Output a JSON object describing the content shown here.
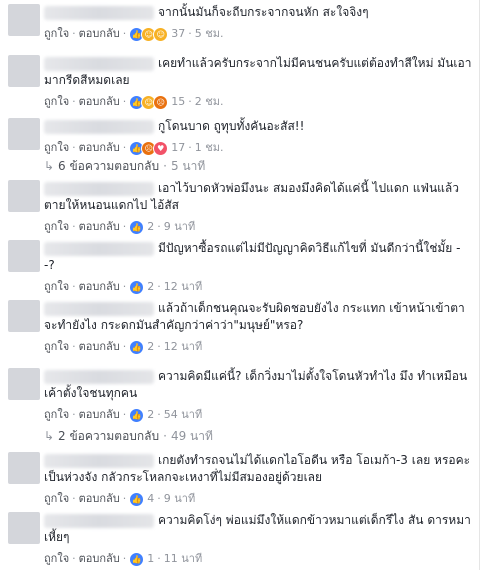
{
  "ui": {
    "like": "ถูกใจ",
    "reply": "ตอบกลับ",
    "dot": "·"
  },
  "comments": [
    {
      "text": "จากนั้นมันก็จะถีบกระจากจนหัก สะใจจิงๆ",
      "count": "37",
      "time": "5 ชม."
    },
    {
      "text": "เคยทำแล้วครับกระจากไม่มีคนชนครับแต่ต้องทำสีใหม่ มันเอามากรีดสีหมดเลย",
      "count": "15",
      "time": "2 ชม."
    },
    {
      "text": "กูโดนบาด ถูทุบทั้งคันอะสัส!!",
      "count": "17",
      "time": "1 ชม."
    },
    {
      "text": "เอาไว้บาดหัวพ่อมึงนะ สมองมึงคิดได้แค่นี้ ไปแดก แฟ่นแล้วตายให้หนอนแดกไป ไอ้สัส",
      "count": "2",
      "time": "9 นาที"
    },
    {
      "text": "มีปัญหาซื้อรถแต่ไม่มีปัญญาคิดวิธีแก้ไขที่ มันดีกว่านี้ใช่มั้ย - -?",
      "count": "2",
      "time": "12 นาที"
    },
    {
      "text": "แล้วถ้าเด็กชนคุณจะรับผิดชอบยังไง กระแทก เข้าหน้าเข้าตาจะทำยังไง กระดกมันสำคัญกว่าค่าว่า\"มนุษย์\"หรอ?",
      "count": "2",
      "time": "12 นาที"
    },
    {
      "text": "ความคิดมีแค่นี้? เด็กวิ่งมาไม่ตั้งใจโดนหัวทำไง มึง ทำเหมือนเค้าตั้งใจชนทุกคน",
      "count": "2",
      "time": "54 นาที"
    },
    {
      "text": "เกยตังทำรถจนไม่ได้แดกไอโอดีน หรือ โอเมก้า-3 เลย หรอคะ เป็นห่วงจัง กลัวกระโหลกจะเหงาที่ไม่มีสมองอยู่ด้วยเลย",
      "count": "4",
      "time": "9 นาที"
    },
    {
      "text": "ความคิดโง่ๆ พ่อแม่มึงให้แดกข้าวหมาแต่เด็กรึไง สัน ดารหมาเหี้ยๆ",
      "count": "1",
      "time": "11 นาที"
    }
  ],
  "replies": [
    {
      "label": "6 ข้อความตอบกลับ",
      "time": "5 นาที"
    },
    {
      "label": "2 ข้อความตอบกลับ",
      "time": "49 นาที"
    }
  ],
  "colors": {
    "like": "#4080ff",
    "haha": "#f7b125",
    "angry": "#e9710f",
    "love": "#f25268"
  }
}
